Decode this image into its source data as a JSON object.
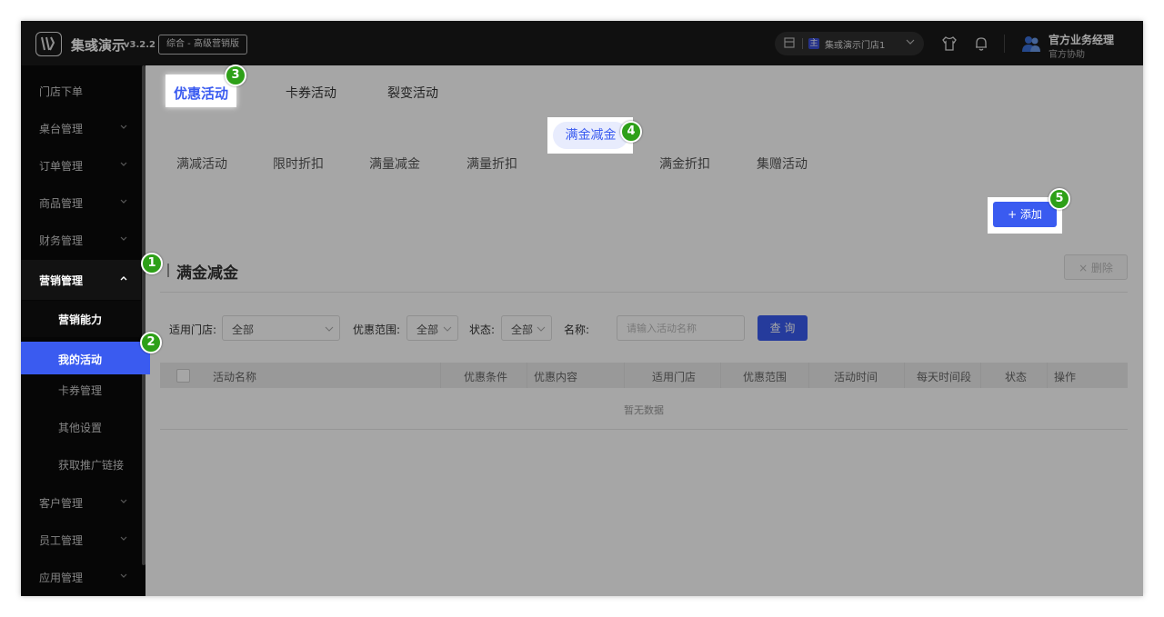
{
  "topbar": {
    "app_name": "集彧演示",
    "version": "v3.2.2",
    "edition": "综合 - 高级营销版",
    "store_badge": "主",
    "store_name": "集彧演示门店1",
    "user_name": "官方业务经理",
    "user_role": "官方协助"
  },
  "sidebar": {
    "items": [
      {
        "label": "门店下单"
      },
      {
        "label": "桌台管理"
      },
      {
        "label": "订单管理"
      },
      {
        "label": "商品管理"
      },
      {
        "label": "财务管理"
      },
      {
        "label": "营销管理"
      },
      {
        "label": "客户管理"
      },
      {
        "label": "员工管理"
      },
      {
        "label": "应用管理"
      }
    ],
    "sub_items": [
      {
        "label": "营销能力"
      },
      {
        "label": "我的活动"
      },
      {
        "label": "卡券管理"
      },
      {
        "label": "其他设置"
      },
      {
        "label": "获取推广链接"
      }
    ]
  },
  "tabs_primary": [
    "优惠活动",
    "卡券活动",
    "裂变活动"
  ],
  "tabs_secondary": [
    "满减活动",
    "限时折扣",
    "满量减金",
    "满量折扣",
    "满金减金",
    "满金折扣",
    "集赠活动"
  ],
  "section": {
    "title": "满金减金",
    "add_label": "+ 添加",
    "delete_label": "× 删除"
  },
  "filters": {
    "store_label": "适用门店:",
    "store_value": "全部",
    "scope_label": "优惠范围:",
    "scope_value": "全部",
    "status_label": "状态:",
    "status_value": "全部",
    "name_label": "名称:",
    "name_placeholder": "请输入活动名称",
    "query_label": "查 询"
  },
  "table": {
    "columns": [
      "活动名称",
      "优惠条件",
      "优惠内容",
      "适用门店",
      "优惠范围",
      "活动时间",
      "每天时间段",
      "状态",
      "操作"
    ],
    "empty_text": "暂无数据"
  },
  "markers": [
    "1",
    "2",
    "3",
    "4",
    "5"
  ],
  "colors": {
    "accent": "#3a5bf0",
    "marker": "#2ea018",
    "topbar": "#1a1a1a",
    "sidebar": "#0a0a0a"
  }
}
